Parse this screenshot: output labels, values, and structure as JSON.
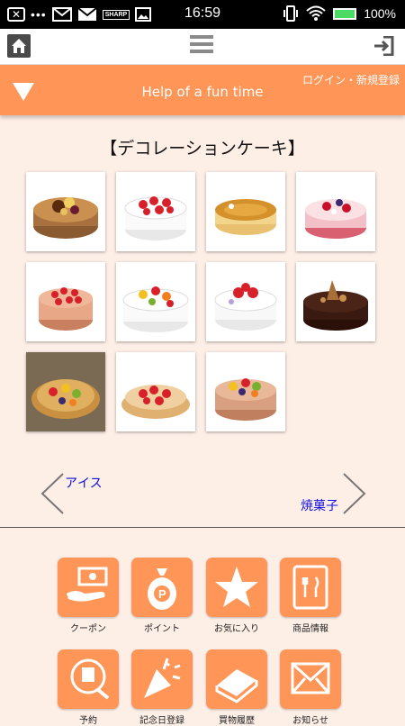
{
  "status_bar": {
    "time": "16:59",
    "battery": "100%",
    "carrier_icon": "SHARP",
    "icons": [
      "close-icon",
      "more-icon",
      "gmail-icon",
      "mail-icon",
      "sharp-icon",
      "image-icon",
      "vibrate-icon",
      "wifi-icon",
      "battery-icon"
    ]
  },
  "toolbar": {
    "home_icon": "home-icon",
    "menu_icon": "hamburger-icon",
    "login_icon": "login-icon"
  },
  "header": {
    "title": "Help of a fun time",
    "login_link": "ログイン・新規登録"
  },
  "section": {
    "title": "【デコレーションケーキ】"
  },
  "cakes": [
    {
      "name": "chestnut-chocolate-cake"
    },
    {
      "name": "strawberry-shortcake"
    },
    {
      "name": "cheesecake"
    },
    {
      "name": "pink-berry-cake"
    },
    {
      "name": "strawberry-cream-cake"
    },
    {
      "name": "fruit-shortcake"
    },
    {
      "name": "strawberry-white-cake"
    },
    {
      "name": "chocolate-nut-cake"
    },
    {
      "name": "fruit-tart"
    },
    {
      "name": "strawberry-tart"
    },
    {
      "name": "fruit-chocolate-cake"
    }
  ],
  "navigation": {
    "prev_label": "アイス",
    "next_label": "焼菓子"
  },
  "menu_tiles": [
    {
      "label": "クーポン",
      "icon": "coupon-icon"
    },
    {
      "label": "ポイント",
      "icon": "point-bag-icon"
    },
    {
      "label": "お気に入り",
      "icon": "star-icon"
    },
    {
      "label": "商品情報",
      "icon": "menu-book-icon"
    },
    {
      "label": "予約",
      "icon": "reservation-icon"
    },
    {
      "label": "記念日登録",
      "icon": "party-popper-icon"
    },
    {
      "label": "買物履歴",
      "icon": "book-icon"
    },
    {
      "label": "お知らせ",
      "icon": "envelope-icon"
    }
  ],
  "colors": {
    "accent": "#ff9556",
    "background": "#fdeee6",
    "link": "#1010e0"
  }
}
